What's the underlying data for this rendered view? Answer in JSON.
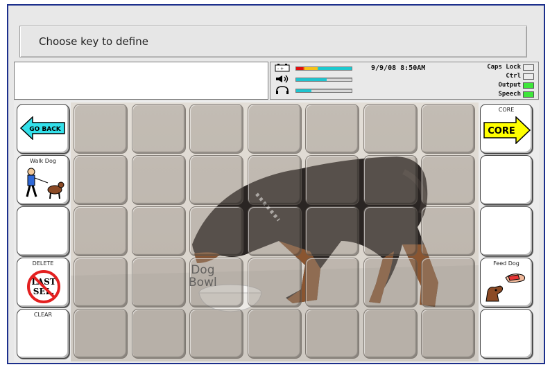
{
  "prompt": {
    "text": "Choose key to define"
  },
  "message_window": {
    "text": ""
  },
  "status": {
    "datetime": "9/9/08 8:50AM",
    "battery_level": 1.0,
    "volume_level": 0.55,
    "headphone_level": 0.28,
    "indicators": [
      {
        "label": "Caps Lock",
        "on": false
      },
      {
        "label": "Ctrl",
        "on": false
      },
      {
        "label": "Output",
        "on": true
      },
      {
        "label": "Speech",
        "on": true
      }
    ]
  },
  "keys": {
    "go_back": {
      "label": "GO BACK"
    },
    "walk_dog": {
      "label": "Walk Dog"
    },
    "delete": {
      "label": "DELETE",
      "icon_text": "LAST SEL."
    },
    "clear": {
      "label": "CLEAR"
    },
    "core": {
      "label": "CORE",
      "icon_text": "CORE"
    },
    "feed_dog": {
      "label": "Feed Dog"
    }
  },
  "scene": {
    "hotspot_label": "Dog Bowl"
  },
  "colors": {
    "frame": "#1c2f8c",
    "go_back_arrow": "#33e0ea",
    "core_arrow": "#ffff00",
    "lamp_on": "#3ee63a"
  }
}
